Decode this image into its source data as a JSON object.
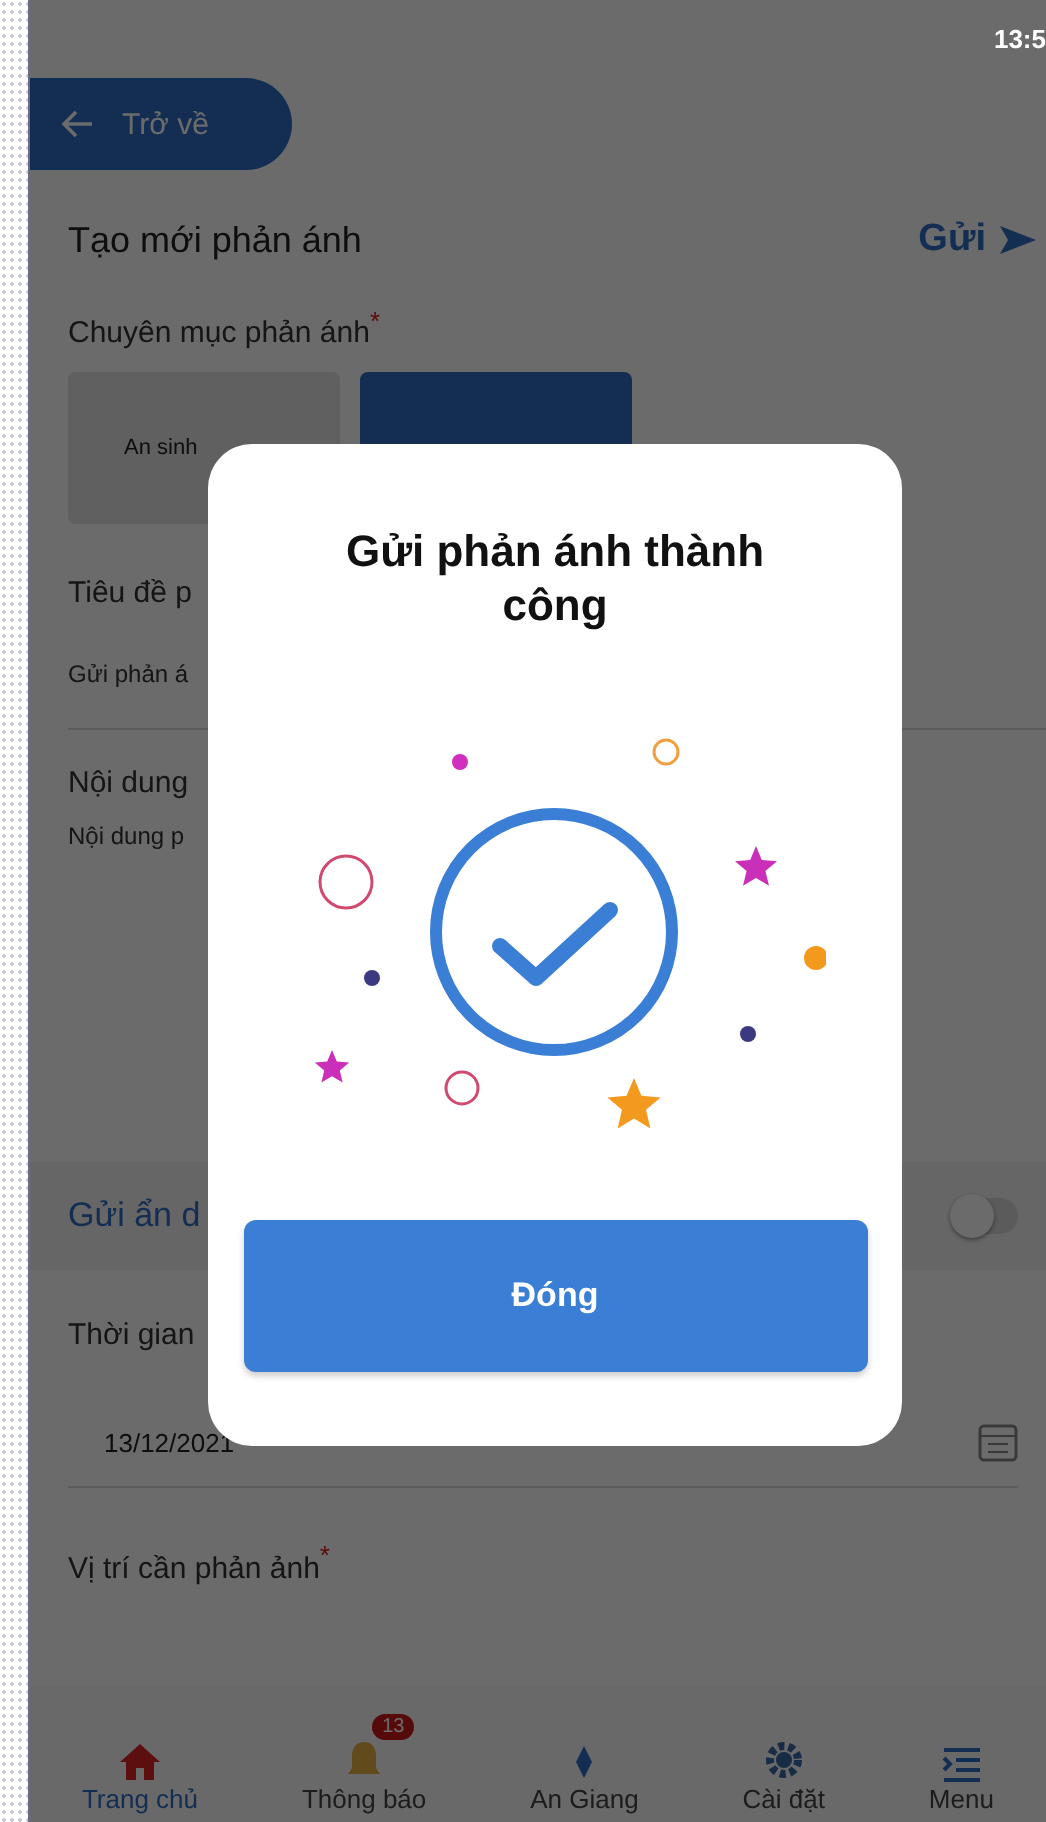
{
  "status_bar": {
    "time": "13:5"
  },
  "back_button": {
    "label": "Trở về"
  },
  "header": {
    "title": "Tạo mới phản ánh",
    "action": "Gửi"
  },
  "category": {
    "label": "Chuyên mục phản ánh",
    "required_mark": "*",
    "chips": [
      {
        "label": "An sinh",
        "selected": false
      },
      {
        "selected": true
      }
    ]
  },
  "title_field": {
    "label": "Tiêu đề p",
    "value": "Gửi phản á"
  },
  "content_field": {
    "label": "Nội dung",
    "placeholder": "Nội dung p"
  },
  "anonymous": {
    "label": "Gửi ẩn d",
    "on": false
  },
  "time_field": {
    "label": "Thời gian",
    "value": "13/12/2021"
  },
  "location_field": {
    "label": "Vị trí cần phản ảnh",
    "required_mark": "*"
  },
  "bottom_nav": [
    {
      "kind": "home",
      "label": "Trang chủ",
      "selected": true
    },
    {
      "kind": "bell",
      "label": "Thông báo",
      "selected": false,
      "badge": "13"
    },
    {
      "kind": "map",
      "label": "An Giang",
      "selected": false
    },
    {
      "kind": "gear",
      "label": "Cài đặt",
      "selected": false
    },
    {
      "kind": "menu",
      "label": "Menu",
      "selected": false
    }
  ],
  "dialog": {
    "title": "Gửi phản ánh thành công",
    "button": "Đóng"
  }
}
